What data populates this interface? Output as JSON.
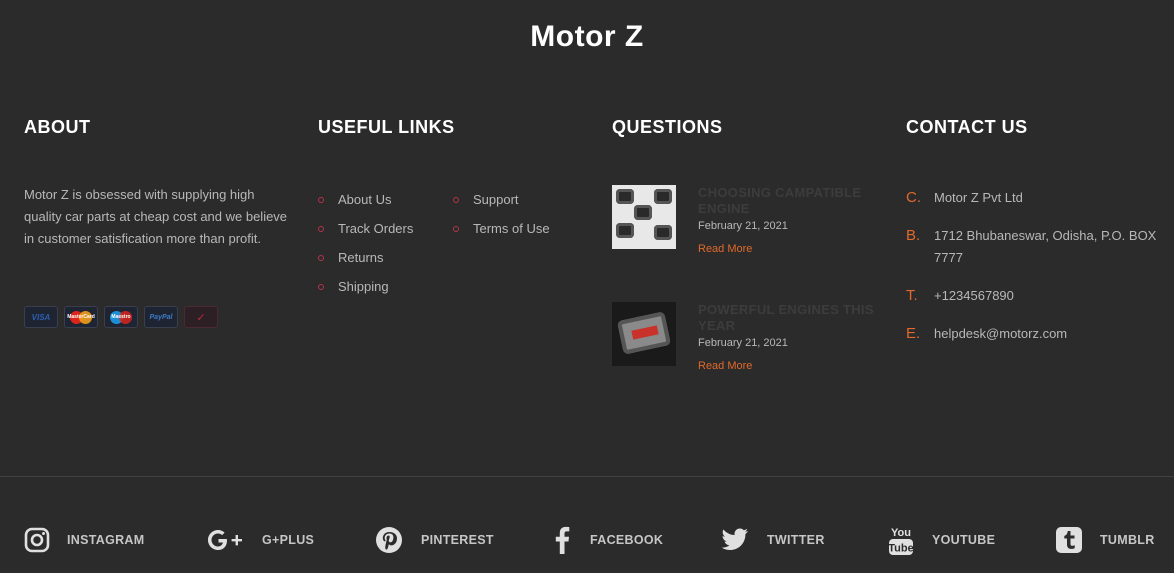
{
  "brand": "Motor Z",
  "about": {
    "heading": "ABOUT",
    "text": "Motor Z is obsessed with supplying high quality car parts at cheap cost and we believe in customer satisfication more than profit.",
    "cards": [
      "VISA",
      "MasterCard",
      "Maestro",
      "PayPal",
      "other-card"
    ]
  },
  "links": {
    "heading": "USEFUL LINKS",
    "col1": [
      "About Us",
      "Track Orders",
      "Returns",
      "Shipping"
    ],
    "col2": [
      "Support",
      "Terms of Use"
    ]
  },
  "questions": {
    "heading": "QUESTIONS",
    "items": [
      {
        "title": "CHOOSING CAMPATIBLE ENGINE",
        "date": "February 21, 2021",
        "more": "Read More"
      },
      {
        "title": "POWERFUL ENGINES THIS YEAR",
        "date": "February 21, 2021",
        "more": "Read More"
      }
    ]
  },
  "contact": {
    "heading": "CONTACT US",
    "items": [
      {
        "label": "C.",
        "value": "Motor Z Pvt Ltd"
      },
      {
        "label": "B.",
        "value": "1712 Bhubaneswar, Odisha, P.O. BOX 7777"
      },
      {
        "label": "T.",
        "value": "+1234567890"
      },
      {
        "label": "E.",
        "value": "helpdesk@motorz.com"
      }
    ]
  },
  "social": [
    {
      "icon": "instagram-icon",
      "label": "INSTAGRAM"
    },
    {
      "icon": "google-plus-icon",
      "label": "G+PLUS"
    },
    {
      "icon": "pinterest-icon",
      "label": "PINTEREST"
    },
    {
      "icon": "facebook-icon",
      "label": "FACEBOOK"
    },
    {
      "icon": "twitter-icon",
      "label": "TWITTER"
    },
    {
      "icon": "youtube-icon",
      "label": "YOUTUBE"
    },
    {
      "icon": "tumblr-icon",
      "label": "TUMBLR"
    }
  ],
  "colors": {
    "background": "#2b2b2b",
    "accent": "#e0692b",
    "bullet": "#b5344a"
  }
}
